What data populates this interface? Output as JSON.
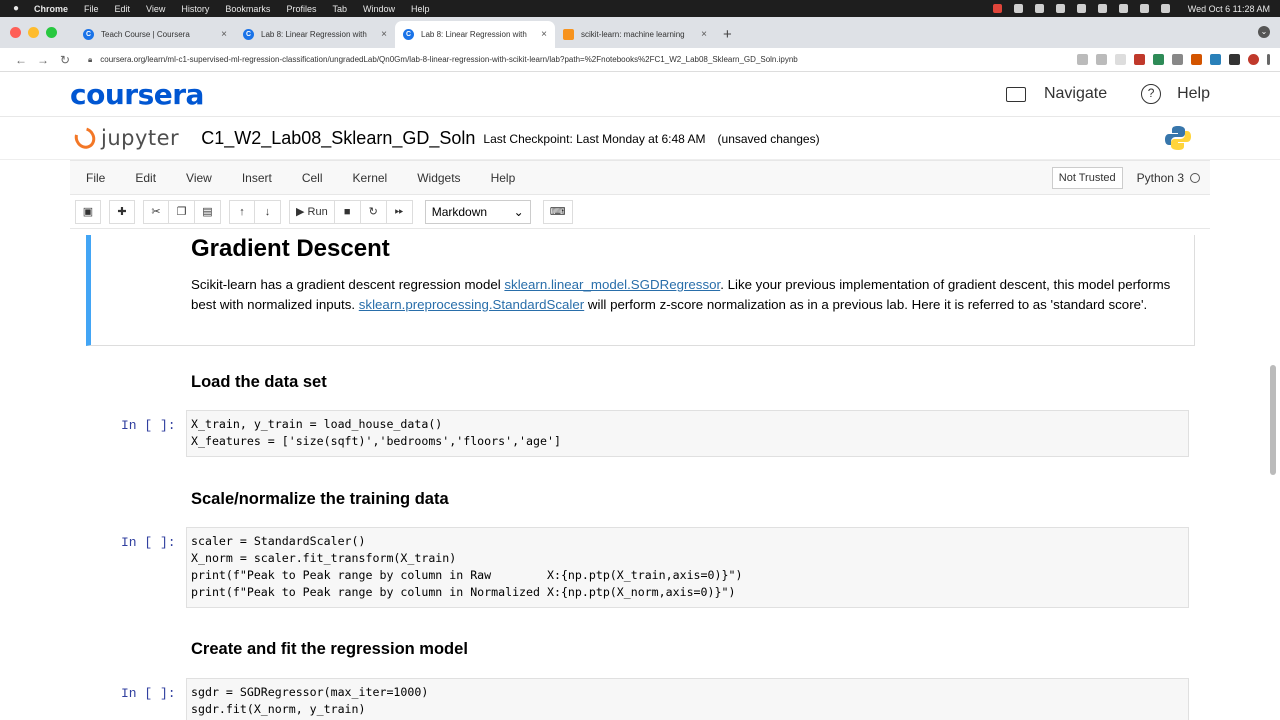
{
  "menubar": {
    "items": [
      "Chrome",
      "File",
      "Edit",
      "View",
      "History",
      "Bookmarks",
      "Profiles",
      "Tab",
      "Window",
      "Help"
    ],
    "clock": "Wed Oct 6  11:28 AM"
  },
  "tabs": [
    {
      "label": "Teach Course | Coursera",
      "close": "×"
    },
    {
      "label": "Lab 8: Linear Regression with",
      "close": "×"
    },
    {
      "label": "Lab 8: Linear Regression with",
      "close": "×"
    },
    {
      "label": "scikit-learn: machine learning",
      "close": "×"
    }
  ],
  "new_tab": "+",
  "address": {
    "url": "coursera.org/learn/ml-c1-supervised-ml-regression-classification/ungradedLab/Qn0Gm/lab-8-linear-regression-with-scikit-learn/lab?path=%2Fnotebooks%2FC1_W2_Lab08_Sklearn_GD_Soln.ipynb"
  },
  "coursera": {
    "logo": "coursera",
    "navigate": "Navigate",
    "help": "Help",
    "help_glyph": "?"
  },
  "jupyter": {
    "logo": "jupyter",
    "notebook_name": "C1_W2_Lab08_Sklearn_GD_Soln",
    "checkpoint": "Last Checkpoint: Last Monday at 6:48 AM",
    "unsaved": "(unsaved changes)",
    "menu": [
      "File",
      "Edit",
      "View",
      "Insert",
      "Cell",
      "Kernel",
      "Widgets",
      "Help"
    ],
    "trusted": "Not Trusted",
    "kernel": "Python 3",
    "toolbar": {
      "run": "Run",
      "cell_type": "Markdown"
    }
  },
  "notebook": {
    "heading": "Gradient Descent",
    "para_1": "Scikit-learn has a gradient descent regression model ",
    "link_1": "sklearn.linear_model.SGDRegressor",
    "para_2": ". Like your previous implementation of gradient descent, this model performs best with normalized inputs. ",
    "link_2": "sklearn.preprocessing.StandardScaler",
    "para_3": " will perform z-score normalization as in a previous lab. Here it is referred to as 'standard score'.",
    "section_1": "Load the data set",
    "prompt_1": "In [ ]:",
    "code_1": "X_train, y_train = load_house_data()\nX_features = ['size(sqft)','bedrooms','floors','age']",
    "section_2": "Scale/normalize the training data",
    "prompt_2": "In [ ]:",
    "code_2": "scaler = StandardScaler()\nX_norm = scaler.fit_transform(X_train)\nprint(f\"Peak to Peak range by column in Raw        X:{np.ptp(X_train,axis=0)}\")\nprint(f\"Peak to Peak range by column in Normalized X:{np.ptp(X_norm,axis=0)}\")",
    "section_3": "Create and fit the regression model",
    "prompt_3": "In [ ]:",
    "code_3": "sgdr = SGDRegressor(max_iter=1000)\nsgdr.fit(X_norm, y_train)"
  },
  "colors": {
    "coursera_blue": "#0056d2",
    "jupyter_orange": "#f37726",
    "link": "#296eaa",
    "prompt": "#303f9f",
    "selected_cell": "#42a5f5"
  }
}
